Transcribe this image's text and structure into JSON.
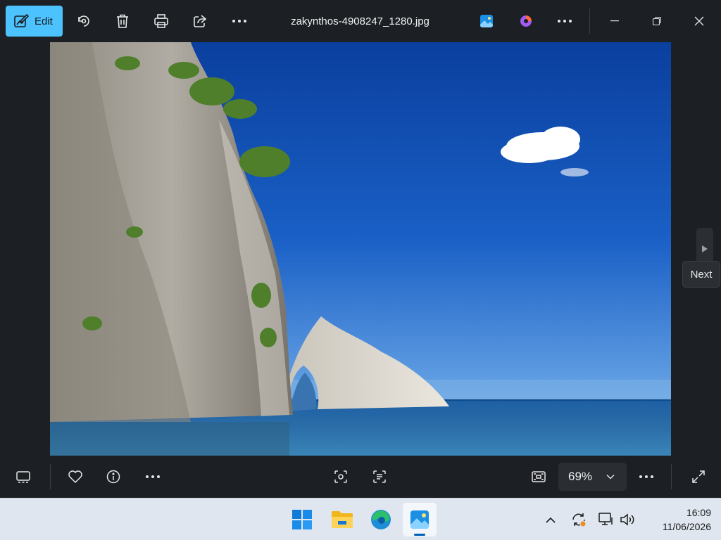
{
  "titlebar": {
    "edit_label": "Edit",
    "filename": "zakynthos-4908247_1280.jpg",
    "icons": [
      "edit-icon",
      "rotate-icon",
      "delete-icon",
      "print-icon",
      "share-icon",
      "more-icon",
      "photos-app-icon",
      "clipchamp-icon",
      "more-icon",
      "minimize-icon",
      "restore-icon",
      "close-icon"
    ]
  },
  "viewer": {
    "next_tooltip": "Next"
  },
  "bottombar": {
    "zoom_level": "69%",
    "icons": [
      "filmstrip-icon",
      "favorite-icon",
      "info-icon",
      "more-icon",
      "visual-search-icon",
      "text-extract-icon",
      "fit-to-window-icon",
      "chevron-down-icon",
      "more-icon",
      "fullscreen-icon"
    ]
  },
  "taskbar": {
    "apps": [
      "windows-start-icon",
      "file-explorer-icon",
      "edge-icon",
      "photos-app-icon"
    ],
    "time": "16:09",
    "date": "11/06/2026"
  },
  "colors": {
    "accent": "#4cc2ff",
    "app_background": "#1c2024",
    "taskbar": "#dfe6ef"
  }
}
